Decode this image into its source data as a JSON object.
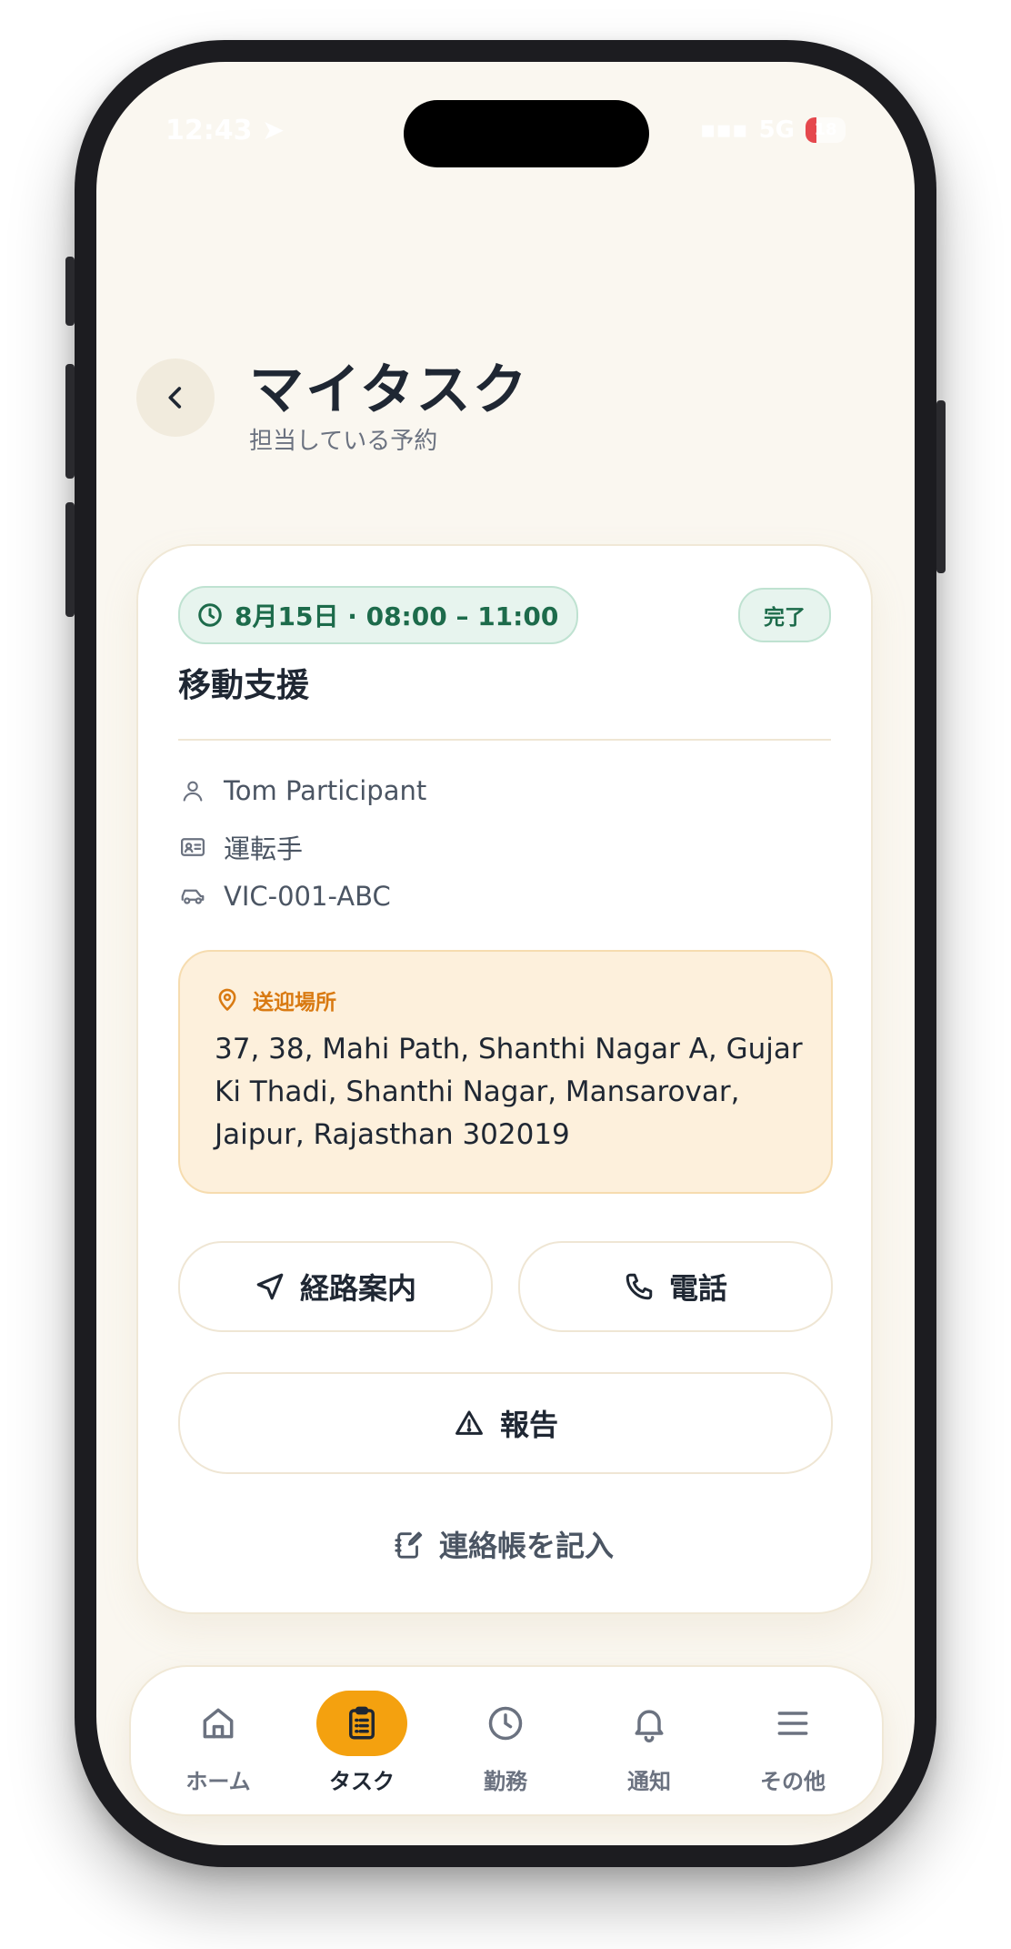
{
  "status_bar": {
    "time": "12:43",
    "network": "5G",
    "battery": "18"
  },
  "header": {
    "title": "マイタスク",
    "subtitle": "担当している予約"
  },
  "task": {
    "time_badge": "8月15日 · 08:00 – 11:00",
    "status": "完了",
    "service": "移動支援",
    "participant": "Tom Participant",
    "role": "運転手",
    "vehicle": "VIC-001-ABC",
    "pickup_label": "送迎場所",
    "pickup_address": "37, 38, Mahi Path, Shanthi Nagar A, Gujar Ki Thadi, Shanthi Nagar, Mansarovar, Jaipur, Rajasthan 302019",
    "navigate_label": "経路案内",
    "call_label": "電話",
    "report_label": "報告",
    "log_label": "連絡帳を記入"
  },
  "tabs": {
    "home": "ホーム",
    "tasks": "タスク",
    "work": "勤務",
    "notifications": "通知",
    "more": "その他",
    "active": "tasks"
  },
  "colors": {
    "accent": "#f4a10f",
    "success_bg": "#e7f4ee",
    "success_text": "#1d6b4b",
    "pickup_bg": "#fdf0dc",
    "pickup_accent": "#d97a12",
    "background": "#faf7f0"
  }
}
